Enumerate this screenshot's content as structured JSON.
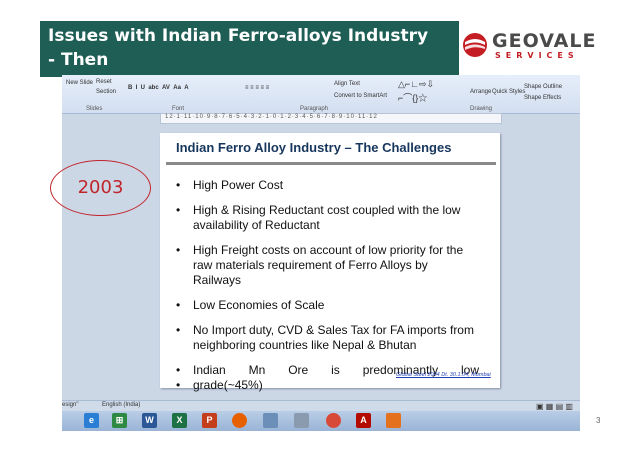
{
  "banner": {
    "line1": "Issues with Indian Ferro-alloys Industry",
    "line2": "- Then",
    "color": "#1e5e54"
  },
  "logo": {
    "word": "GEOVALE",
    "sub": "SERVICES",
    "icon": "geovale-globe-icon",
    "colors": {
      "primary": "#c41e24",
      "text": "#4a4a4a"
    }
  },
  "powerpoint": {
    "ribbon": {
      "new_slide": "New Slide",
      "reset": "Reset",
      "section": "Section",
      "slides_group": "Slides",
      "font_group": "Font",
      "paragraph_group": "Paragraph",
      "drawing_group": "Drawing",
      "align_text": "Align Text",
      "convert_smartart": "Convert to SmartArt",
      "arrange": "Arrange",
      "quick_styles": "Quick Styles",
      "shape_outline": "Shape Outline",
      "shape_effects": "Shape Effects"
    },
    "status_bar": {
      "theme": "esign\"",
      "language": "English (India)"
    },
    "taskbar_icons": [
      "ie-icon",
      "store-icon",
      "word-icon",
      "excel-icon",
      "powerpoint-icon",
      "firefox-icon",
      "notepad-icon",
      "media-icon",
      "chrome-icon",
      "acrobat-icon",
      "office-icon"
    ]
  },
  "slide": {
    "title": "Indian Ferro Alloy Industry – The Challenges",
    "bullets": [
      "High Power Cost",
      "High & Rising Reductant cost coupled with the low availability of Reductant",
      "High Freight costs on account of low priority for the raw materials requirement of Ferro Alloys by Railways",
      "Low Economies of Scale",
      "No Import duty, CVD & Sales Tax for FA imports from neighboring countries like Nepal & Bhutan",
      "Indian Mn Ore is predominantly low",
      "grade(~45%)"
    ],
    "source": "Global Steel 2004 Dt. 30.1.04, Mumbai"
  },
  "callout": {
    "year": "2003",
    "color": "#c0252b"
  },
  "page_number": "3"
}
